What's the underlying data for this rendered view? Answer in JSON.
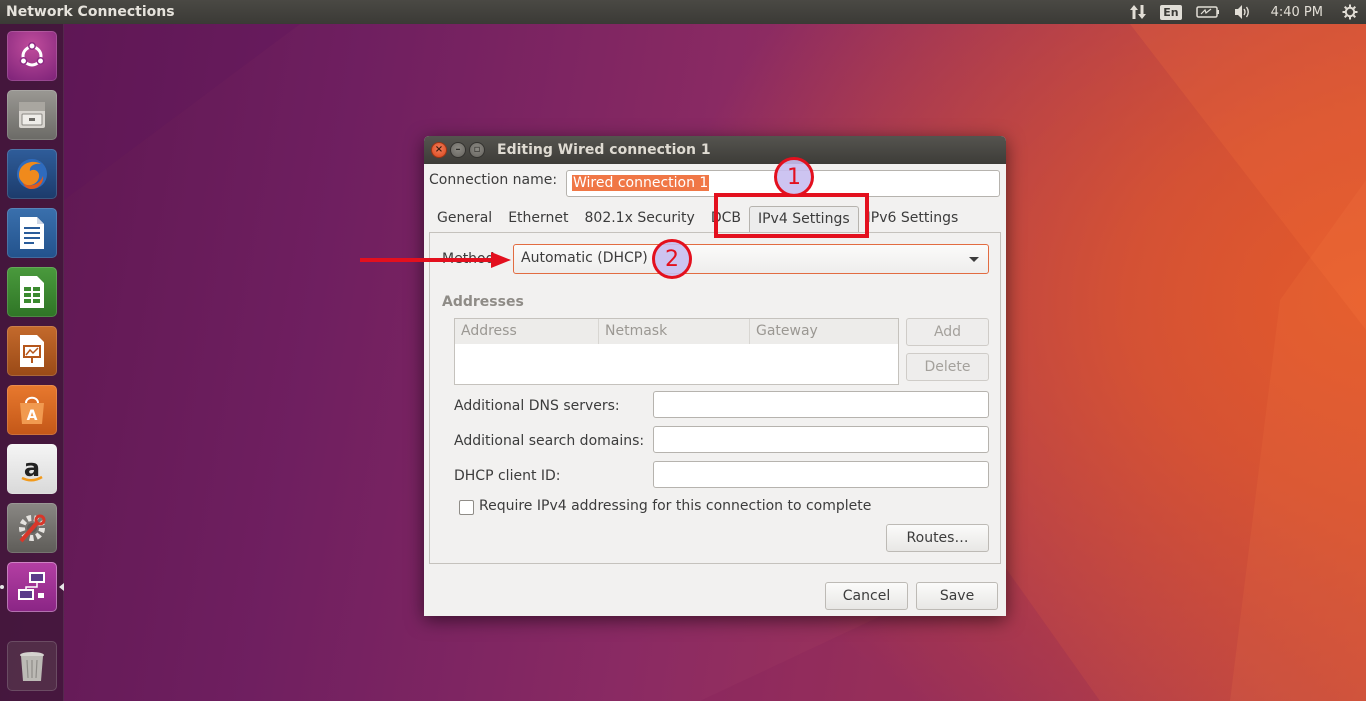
{
  "top_panel": {
    "app_title": "Network Connections",
    "keyboard_layout": "En",
    "clock": "4:40 PM",
    "icons": [
      "network-transfer-icon",
      "keyboard-layout-icon",
      "battery-icon",
      "volume-icon",
      "gear-icon"
    ]
  },
  "launcher": {
    "items": [
      {
        "name": "ubuntu-dash",
        "icon": "ubuntu-logo-icon"
      },
      {
        "name": "files",
        "icon": "file-cabinet-icon"
      },
      {
        "name": "firefox",
        "icon": "firefox-icon"
      },
      {
        "name": "libreoffice-writer",
        "icon": "writer-icon"
      },
      {
        "name": "libreoffice-calc",
        "icon": "calc-icon"
      },
      {
        "name": "libreoffice-impress",
        "icon": "impress-icon"
      },
      {
        "name": "ubuntu-software",
        "icon": "software-center-icon"
      },
      {
        "name": "amazon",
        "icon": "amazon-icon"
      },
      {
        "name": "system-settings",
        "icon": "settings-wrench-icon"
      },
      {
        "name": "network-connections",
        "icon": "network-connections-icon"
      },
      {
        "name": "trash",
        "icon": "trash-icon"
      }
    ]
  },
  "dialog": {
    "title": "Editing Wired connection 1",
    "connection_name_label": "Connection name:",
    "connection_name_value": "Wired connection 1",
    "tabs": [
      {
        "label": "General"
      },
      {
        "label": "Ethernet"
      },
      {
        "label": "802.1x Security"
      },
      {
        "label": "DCB"
      },
      {
        "label": "IPv4 Settings"
      },
      {
        "label": "IPv6 Settings"
      }
    ],
    "active_tab": "IPv4 Settings",
    "method_label": "Method:",
    "method_value": "Automatic (DHCP)",
    "addresses_title": "Addresses",
    "addresses_columns": [
      "Address",
      "Netmask",
      "Gateway"
    ],
    "add_label": "Add",
    "delete_label": "Delete",
    "dns_label": "Additional DNS servers:",
    "search_domains_label": "Additional search domains:",
    "dhcp_client_id_label": "DHCP client ID:",
    "require_ipv4_label": "Require IPv4 addressing for this connection to complete",
    "require_ipv4_checked": false,
    "routes_label": "Routes…",
    "cancel_label": "Cancel",
    "save_label": "Save"
  },
  "annotations": {
    "step1": "1",
    "step2": "2",
    "color": "#e3101e"
  }
}
